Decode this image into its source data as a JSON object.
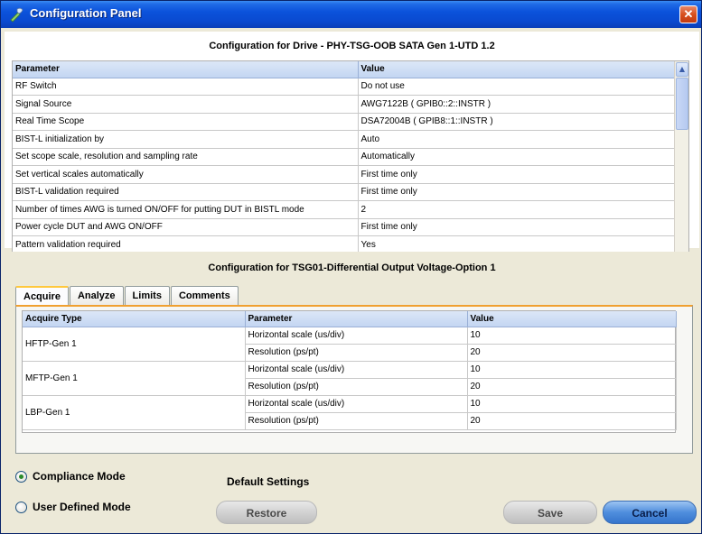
{
  "window": {
    "title": "Configuration Panel",
    "close_glyph": "✕",
    "icon": "tool-icon"
  },
  "drive": {
    "heading": "Configuration for Drive - PHY-TSG-OOB SATA Gen 1-UTD 1.2",
    "columns": [
      "Parameter",
      "Value"
    ],
    "rows": [
      [
        "RF Switch",
        "Do not use"
      ],
      [
        "Signal Source",
        "AWG7122B ( GPIB0::2::INSTR )"
      ],
      [
        "Real Time Scope",
        "DSA72004B ( GPIB8::1::INSTR )"
      ],
      [
        "BIST-L initialization by",
        "Auto"
      ],
      [
        "Set scope scale, resolution and sampling rate",
        "Automatically"
      ],
      [
        "Set vertical scales automatically",
        "First time only"
      ],
      [
        "BIST-L validation required",
        "First time only"
      ],
      [
        "Number of times AWG is turned ON/OFF for putting DUT in BISTL mode",
        "2"
      ],
      [
        "Power cycle DUT and AWG ON/OFF",
        "First time only"
      ],
      [
        "Pattern validation required",
        "Yes"
      ]
    ]
  },
  "test": {
    "heading": "Configuration for TSG01-Differential Output Voltage-Option 1",
    "tabs": [
      "Acquire",
      "Analyze",
      "Limits",
      "Comments"
    ],
    "active_tab": "Acquire",
    "columns": [
      "Acquire Type",
      "Parameter",
      "Value"
    ],
    "groups": [
      {
        "type": "HFTP-Gen 1",
        "params": [
          [
            "Horizontal scale (us/div)",
            "10"
          ],
          [
            "Resolution (ps/pt)",
            "20"
          ]
        ]
      },
      {
        "type": "MFTP-Gen 1",
        "params": [
          [
            "Horizontal scale (us/div)",
            "10"
          ],
          [
            "Resolution (ps/pt)",
            "20"
          ]
        ]
      },
      {
        "type": "LBP-Gen 1",
        "params": [
          [
            "Horizontal scale (us/div)",
            "10"
          ],
          [
            "Resolution (ps/pt)",
            "20"
          ]
        ]
      }
    ]
  },
  "modes": {
    "compliance": "Compliance Mode",
    "user_defined": "User Defined Mode",
    "selected": "compliance"
  },
  "default_settings_label": "Default Settings",
  "buttons": {
    "restore": "Restore",
    "save": "Save",
    "cancel": "Cancel"
  },
  "colors": {
    "titlebar": "#0A4AD0",
    "tab_accent": "#F0A030",
    "cancel": "#4F8EDD"
  }
}
